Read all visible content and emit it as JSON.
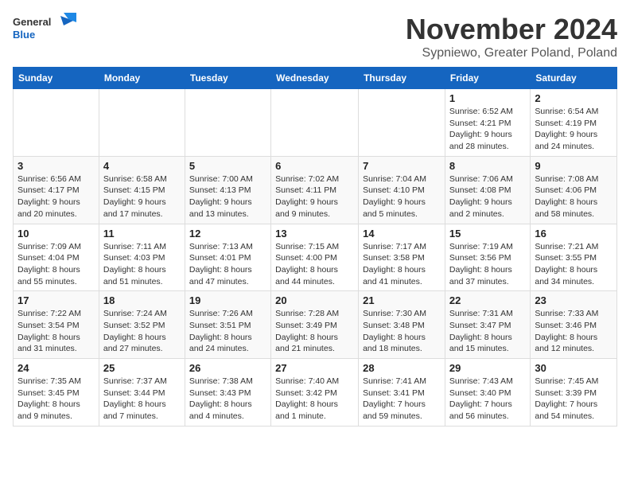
{
  "logo": {
    "line1": "General",
    "line2": "Blue"
  },
  "title": "November 2024",
  "subtitle": "Sypniewo, Greater Poland, Poland",
  "weekdays": [
    "Sunday",
    "Monday",
    "Tuesday",
    "Wednesday",
    "Thursday",
    "Friday",
    "Saturday"
  ],
  "weeks": [
    [
      {
        "day": "",
        "info": ""
      },
      {
        "day": "",
        "info": ""
      },
      {
        "day": "",
        "info": ""
      },
      {
        "day": "",
        "info": ""
      },
      {
        "day": "",
        "info": ""
      },
      {
        "day": "1",
        "info": "Sunrise: 6:52 AM\nSunset: 4:21 PM\nDaylight: 9 hours and 28 minutes."
      },
      {
        "day": "2",
        "info": "Sunrise: 6:54 AM\nSunset: 4:19 PM\nDaylight: 9 hours and 24 minutes."
      }
    ],
    [
      {
        "day": "3",
        "info": "Sunrise: 6:56 AM\nSunset: 4:17 PM\nDaylight: 9 hours and 20 minutes."
      },
      {
        "day": "4",
        "info": "Sunrise: 6:58 AM\nSunset: 4:15 PM\nDaylight: 9 hours and 17 minutes."
      },
      {
        "day": "5",
        "info": "Sunrise: 7:00 AM\nSunset: 4:13 PM\nDaylight: 9 hours and 13 minutes."
      },
      {
        "day": "6",
        "info": "Sunrise: 7:02 AM\nSunset: 4:11 PM\nDaylight: 9 hours and 9 minutes."
      },
      {
        "day": "7",
        "info": "Sunrise: 7:04 AM\nSunset: 4:10 PM\nDaylight: 9 hours and 5 minutes."
      },
      {
        "day": "8",
        "info": "Sunrise: 7:06 AM\nSunset: 4:08 PM\nDaylight: 9 hours and 2 minutes."
      },
      {
        "day": "9",
        "info": "Sunrise: 7:08 AM\nSunset: 4:06 PM\nDaylight: 8 hours and 58 minutes."
      }
    ],
    [
      {
        "day": "10",
        "info": "Sunrise: 7:09 AM\nSunset: 4:04 PM\nDaylight: 8 hours and 55 minutes."
      },
      {
        "day": "11",
        "info": "Sunrise: 7:11 AM\nSunset: 4:03 PM\nDaylight: 8 hours and 51 minutes."
      },
      {
        "day": "12",
        "info": "Sunrise: 7:13 AM\nSunset: 4:01 PM\nDaylight: 8 hours and 47 minutes."
      },
      {
        "day": "13",
        "info": "Sunrise: 7:15 AM\nSunset: 4:00 PM\nDaylight: 8 hours and 44 minutes."
      },
      {
        "day": "14",
        "info": "Sunrise: 7:17 AM\nSunset: 3:58 PM\nDaylight: 8 hours and 41 minutes."
      },
      {
        "day": "15",
        "info": "Sunrise: 7:19 AM\nSunset: 3:56 PM\nDaylight: 8 hours and 37 minutes."
      },
      {
        "day": "16",
        "info": "Sunrise: 7:21 AM\nSunset: 3:55 PM\nDaylight: 8 hours and 34 minutes."
      }
    ],
    [
      {
        "day": "17",
        "info": "Sunrise: 7:22 AM\nSunset: 3:54 PM\nDaylight: 8 hours and 31 minutes."
      },
      {
        "day": "18",
        "info": "Sunrise: 7:24 AM\nSunset: 3:52 PM\nDaylight: 8 hours and 27 minutes."
      },
      {
        "day": "19",
        "info": "Sunrise: 7:26 AM\nSunset: 3:51 PM\nDaylight: 8 hours and 24 minutes."
      },
      {
        "day": "20",
        "info": "Sunrise: 7:28 AM\nSunset: 3:49 PM\nDaylight: 8 hours and 21 minutes."
      },
      {
        "day": "21",
        "info": "Sunrise: 7:30 AM\nSunset: 3:48 PM\nDaylight: 8 hours and 18 minutes."
      },
      {
        "day": "22",
        "info": "Sunrise: 7:31 AM\nSunset: 3:47 PM\nDaylight: 8 hours and 15 minutes."
      },
      {
        "day": "23",
        "info": "Sunrise: 7:33 AM\nSunset: 3:46 PM\nDaylight: 8 hours and 12 minutes."
      }
    ],
    [
      {
        "day": "24",
        "info": "Sunrise: 7:35 AM\nSunset: 3:45 PM\nDaylight: 8 hours and 9 minutes."
      },
      {
        "day": "25",
        "info": "Sunrise: 7:37 AM\nSunset: 3:44 PM\nDaylight: 8 hours and 7 minutes."
      },
      {
        "day": "26",
        "info": "Sunrise: 7:38 AM\nSunset: 3:43 PM\nDaylight: 8 hours and 4 minutes."
      },
      {
        "day": "27",
        "info": "Sunrise: 7:40 AM\nSunset: 3:42 PM\nDaylight: 8 hours and 1 minute."
      },
      {
        "day": "28",
        "info": "Sunrise: 7:41 AM\nSunset: 3:41 PM\nDaylight: 7 hours and 59 minutes."
      },
      {
        "day": "29",
        "info": "Sunrise: 7:43 AM\nSunset: 3:40 PM\nDaylight: 7 hours and 56 minutes."
      },
      {
        "day": "30",
        "info": "Sunrise: 7:45 AM\nSunset: 3:39 PM\nDaylight: 7 hours and 54 minutes."
      }
    ]
  ]
}
